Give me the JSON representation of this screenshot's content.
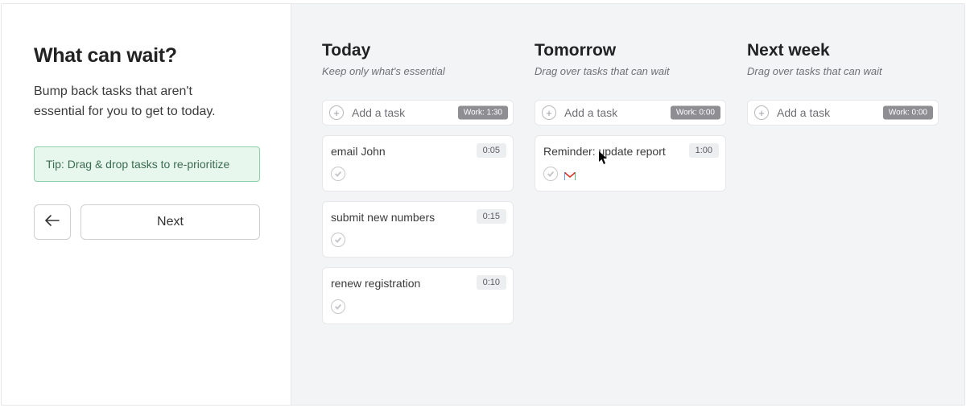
{
  "sidebar": {
    "title": "What can wait?",
    "description": "Bump back tasks that aren't essential for you to get to today.",
    "tip": "Tip: Drag & drop tasks to re-prioritize",
    "next_label": "Next"
  },
  "board": {
    "add_task_label": "Add a task",
    "columns": [
      {
        "title": "Today",
        "subtitle": "Keep only what's essential",
        "work_badge": "Work: 1:30",
        "badge_style": "dark",
        "tasks": [
          {
            "title": "email John",
            "duration": "0:05",
            "icons": []
          },
          {
            "title": "submit new numbers",
            "duration": "0:15",
            "icons": []
          },
          {
            "title": "renew registration",
            "duration": "0:10",
            "icons": []
          }
        ]
      },
      {
        "title": "Tomorrow",
        "subtitle": "Drag over tasks that can wait",
        "work_badge": "Work: 0:00",
        "badge_style": "dark",
        "tasks": [
          {
            "title": "Reminder: update report",
            "duration": "1:00",
            "icons": [
              "gmail"
            ]
          }
        ]
      },
      {
        "title": "Next week",
        "subtitle": "Drag over tasks that can wait",
        "work_badge": "Work: 0:00",
        "badge_style": "dark",
        "tasks": []
      }
    ]
  }
}
